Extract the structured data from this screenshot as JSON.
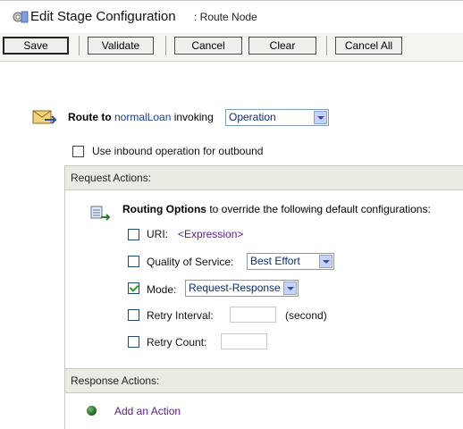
{
  "header": {
    "title": "Edit Stage Configuration",
    "subtitle": ": Route Node",
    "icon": "stage-config-icon"
  },
  "toolbar": {
    "save": "Save",
    "validate": "Validate",
    "cancel": "Cancel",
    "clear": "Clear",
    "cancel_all": "Cancel All"
  },
  "route": {
    "label": "Route to",
    "target": "normalLoan",
    "invoking": "invoking",
    "operation_selected": "Operation",
    "inbound_label": "Use inbound operation for outbound",
    "inbound_checked": false
  },
  "request_actions": {
    "header": "Request Actions:",
    "routing_bold": "Routing Options",
    "routing_rest": " to override the following default configurations:",
    "uri_label": "URI:",
    "uri_value": "<Expression>",
    "qos_label": "Quality of Service:",
    "qos_value": "Best Effort",
    "mode_label": "Mode:",
    "mode_value": "Request-Response",
    "mode_checked": true,
    "retry_interval_label": "Retry Interval:",
    "retry_interval_unit": "(second)",
    "retry_count_label": "Retry Count:"
  },
  "response_actions": {
    "header": "Response Actions:",
    "add_action": "Add an Action"
  },
  "colors": {
    "toolbar_bg": "#f4f4f1",
    "section_bg": "#ebebe4",
    "link_blue": "#1c3c9c",
    "link_purple": "#5b1a8f",
    "check_green": "#21a121"
  }
}
